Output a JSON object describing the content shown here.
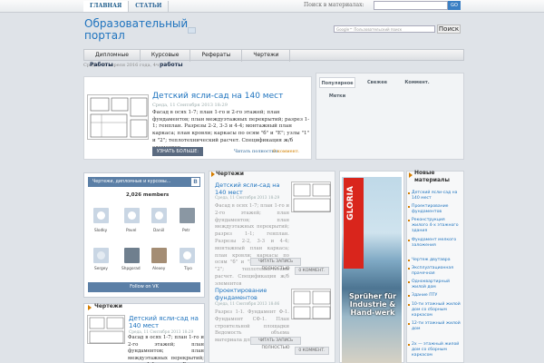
{
  "top_nav": {
    "items": [
      "ГЛАВНАЯ",
      "СТАТЬИ"
    ],
    "search_label": "Поиск в материалах:",
    "go_label": "GO"
  },
  "header": {
    "site_title": "Образовательный портал",
    "google_placeholder": "Google™ Пользовательский поиск",
    "search_button": "Поиск"
  },
  "main_menu": {
    "items": [
      "Дипломные",
      "Курсовые",
      "Рефераты",
      "Чертежи"
    ]
  },
  "submenu": {
    "date_text": "Среда, 11 апреля 2016 года, 4ч",
    "item_a": "Работы",
    "item_b": "работы"
  },
  "featured": {
    "title": "Детский ясли-сад на 140 мест",
    "date": "Среда, 11 Сентября 2013 18:29",
    "text": "Фасад в осях 1-7; план 1-го и 2-го этажей; план фундаментов; план междуэтажных перекрытий; разрез 1-1; генплан. Разрезы 2-2, 3-3 и 4-4; монтажный план каркаса; план кровли; каркасы по осям \"б\" и \"Е\"; узлы \"1\" и \"2\"; теплотехнический расчет. Спецификация ж/б элементов",
    "more_button": "УЗНАТЬ БОЛЬШЕ:",
    "read_link": "Читать полностью",
    "comments": "0 коммент."
  },
  "tabs": {
    "items": [
      "Популярное",
      "Свежее",
      "Коммент.",
      "Метки"
    ]
  },
  "vk": {
    "header": "Чертежи, дипломные и курсовы...",
    "badge": "В",
    "members": "2,026 members",
    "people": [
      "Slodky",
      "Pavel",
      "Daniil",
      "Petr",
      "Sergey",
      "Shpgorad",
      "Alexey",
      "Tiyo"
    ],
    "follow": "Follow on VK"
  },
  "left_box": {
    "header": "Чертежи",
    "title": "Детский ясли-сад на 140 мест",
    "date": "Среда, 11 Сентября 2013 18:29",
    "text": "Фасад в осях 1-7; план 1-го и 2-го этажей; план фундаментов; план междуэтажных перекрытий; разрез 1-1; генплан. Разрезы 2-2"
  },
  "middle": {
    "header": "Чертежи",
    "posts": [
      {
        "title": "Детский ясли-сад на 140 мест",
        "date": "Среда, 11 Сентября 2013 18:29",
        "text": "Фасад в осях 1-7; план 1-го и 2-го этажей; план фундаментов; план междуэтажных перекрытий; разрез 1-1; генплан. Разрезы 2-2, 3-3 и 4-4; монтажный план каркаса; план кровли; каркасы по осям \"б\" и \"Е\"; узлы \"1\" и \"2\"; теплотехнический расчет. Спецификация ж/б элементов",
        "read": "ЧИТАТЬ ЗАПИСЬ ПОЛНОСТЬЮ",
        "comments": "0 КОММЕНТ."
      },
      {
        "title": "Проектирование фундаментов",
        "date": "Среда, 11 Сентября 2013 18:06",
        "text": "Разрез 1-1. Фундамент Ф-1. Фундамент СФ-1. План строительной площадки Ведомость объема материала для Ф-1 и СФ-1",
        "read": "ЧИТАТЬ ЗАПИСЬ ПОЛНОСТЬЮ",
        "comments": "0 КОММЕНТ."
      }
    ]
  },
  "ad": {
    "brand": "GLORIA",
    "slogan": "Sprüher für Industrie & Hand-werk"
  },
  "right_list": {
    "header": "Новые материалы",
    "items": [
      "Детский ясли-сад на 140 мест",
      "Проектирование фундаментов",
      "Реконструкция жилого 4-х этажного здания",
      "Фундамент мелкого заложения",
      "Чертеж двутавра",
      "Эксплуатационная прачечная",
      "Одноквартирный жилой дом",
      "Здание ПТУ",
      "10-ти этажный жилой дом со сборным каркасом",
      "12-ти этажный жилой дом",
      "2х — этажный жилой дом со сборным каркасом"
    ]
  },
  "colors": {
    "link": "#1e73be",
    "accent": "#d47d00",
    "vk": "#5b7fa6",
    "ad_red": "#d9251c"
  }
}
